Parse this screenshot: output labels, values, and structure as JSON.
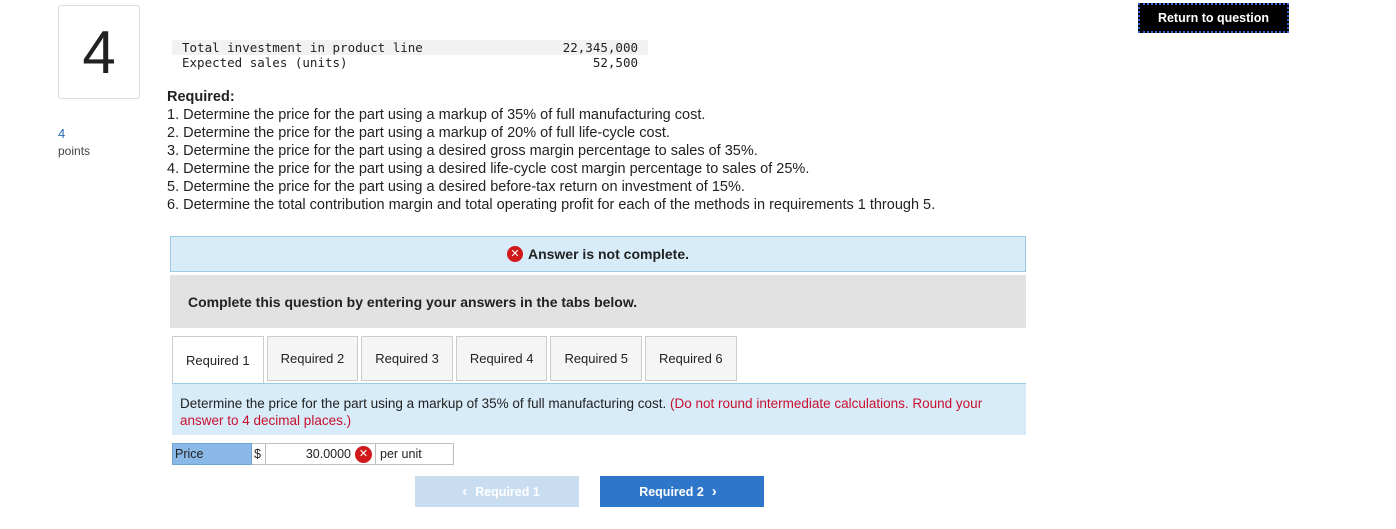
{
  "question": {
    "number": "4",
    "points_value": "4",
    "points_label": "points"
  },
  "data_table": [
    {
      "label": "Total investment in product line",
      "value": "22,345,000"
    },
    {
      "label": "Expected sales (units)",
      "value": "52,500"
    }
  ],
  "required": {
    "title": "Required:",
    "items": [
      "1. Determine the price for the part using a markup of 35% of full manufacturing cost.",
      "2. Determine the price for the part using a markup of 20% of full life-cycle cost.",
      "3. Determine the price for the part using a desired gross margin percentage to sales of 35%.",
      "4. Determine the price for the part using a desired life-cycle cost margin percentage to sales of 25%.",
      "5. Determine the price for the part using a desired before-tax return on investment of 15%.",
      "6. Determine the total contribution margin and total operating profit for each of the methods in requirements 1 through 5."
    ]
  },
  "status": {
    "text": "Answer is not complete.",
    "icon": "x-circle-icon",
    "color": "#d0191a"
  },
  "instructions": "Complete this question by entering your answers in the tabs below.",
  "tabs": [
    {
      "label": "Required 1",
      "active": true
    },
    {
      "label": "Required 2",
      "active": false
    },
    {
      "label": "Required 3",
      "active": false
    },
    {
      "label": "Required 4",
      "active": false
    },
    {
      "label": "Required 5",
      "active": false
    },
    {
      "label": "Required 6",
      "active": false
    }
  ],
  "tab_panel": {
    "text": "Determine the price for the part using a markup of 35% of full manufacturing cost.",
    "note": "(Do not round intermediate calculations. Round your answer to 4 decimal places.)"
  },
  "answer": {
    "label": "Price",
    "currency": "$",
    "value": "30.0000",
    "unit": "per unit"
  },
  "nav": {
    "prev_label": "Required 1",
    "next_label": "Required 2"
  },
  "return_label": "Return to question",
  "colors": {
    "accent_blue": "#2e76c9",
    "banner_bg": "#d8ebf8",
    "error_red": "#c8102e"
  }
}
